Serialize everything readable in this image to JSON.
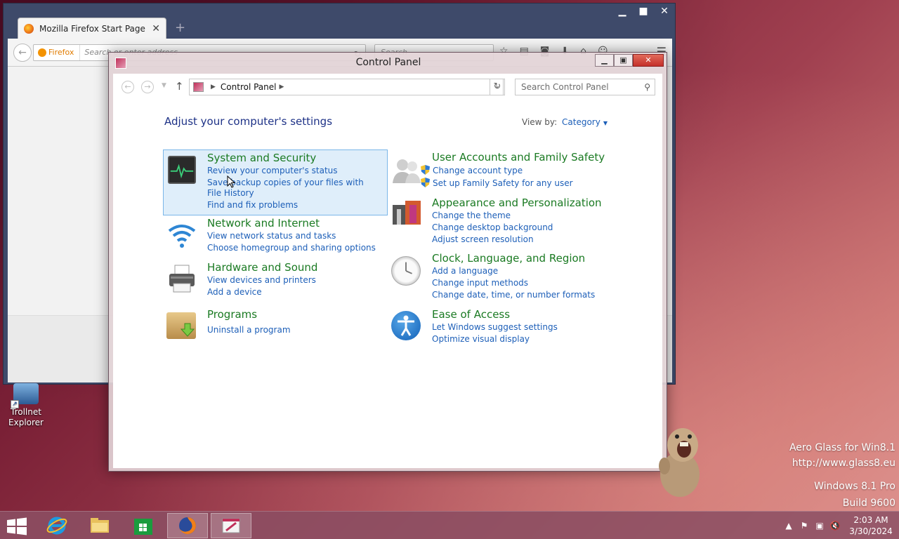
{
  "firefox": {
    "tab_title": "Mozilla Firefox Start Page",
    "identity_label": "Firefox",
    "url_placeholder": "Search or enter address",
    "search_placeholder": "Search"
  },
  "desktop": {
    "icons": [
      {
        "label_line1": "Trollnet",
        "label_line2": "Explorer"
      }
    ]
  },
  "control_panel": {
    "window_title": "Control Panel",
    "address_crumb": "Control Panel",
    "search_placeholder": "Search Control Panel",
    "heading": "Adjust your computer's settings",
    "view_by_label": "View by:",
    "view_by_value": "Category",
    "categories": [
      {
        "title": "System and Security",
        "links": [
          "Review your computer's status",
          "Save backup copies of your files with File History",
          "Find and fix problems"
        ],
        "icon": "system-monitor-icon"
      },
      {
        "title": "Network and Internet",
        "links": [
          "View network status and tasks",
          "Choose homegroup and sharing options"
        ],
        "icon": "network-wifi-icon"
      },
      {
        "title": "Hardware and Sound",
        "links": [
          "View devices and printers",
          "Add a device"
        ],
        "icon": "printer-icon"
      },
      {
        "title": "Programs",
        "links": [
          "Uninstall a program"
        ],
        "icon": "programs-box-icon"
      },
      {
        "title": "User Accounts and Family Safety",
        "links": [
          "Change account type",
          "Set up Family Safety for any user"
        ],
        "icon": "users-icon"
      },
      {
        "title": "Appearance and Personalization",
        "links": [
          "Change the theme",
          "Change desktop background",
          "Adjust screen resolution"
        ],
        "icon": "appearance-icon"
      },
      {
        "title": "Clock, Language, and Region",
        "links": [
          "Add a language",
          "Change input methods",
          "Change date, time, or number formats"
        ],
        "icon": "clock-icon"
      },
      {
        "title": "Ease of Access",
        "links": [
          "Let Windows suggest settings",
          "Optimize visual display"
        ],
        "icon": "accessibility-icon"
      }
    ]
  },
  "watermark": {
    "line1": "Aero Glass for Win8.1",
    "line2": "http://www.glass8.eu",
    "line3": "Windows 8.1 Pro",
    "line4": "Build 9600"
  },
  "taskbar": {
    "time": "2:03 AM",
    "date": "3/30/2024"
  },
  "colors": {
    "category_title": "#1a7a22",
    "link": "#1d5fb8",
    "heading": "#1e3287",
    "selection_bg": "#dfeefa",
    "selection_border": "#7ab6e8"
  }
}
